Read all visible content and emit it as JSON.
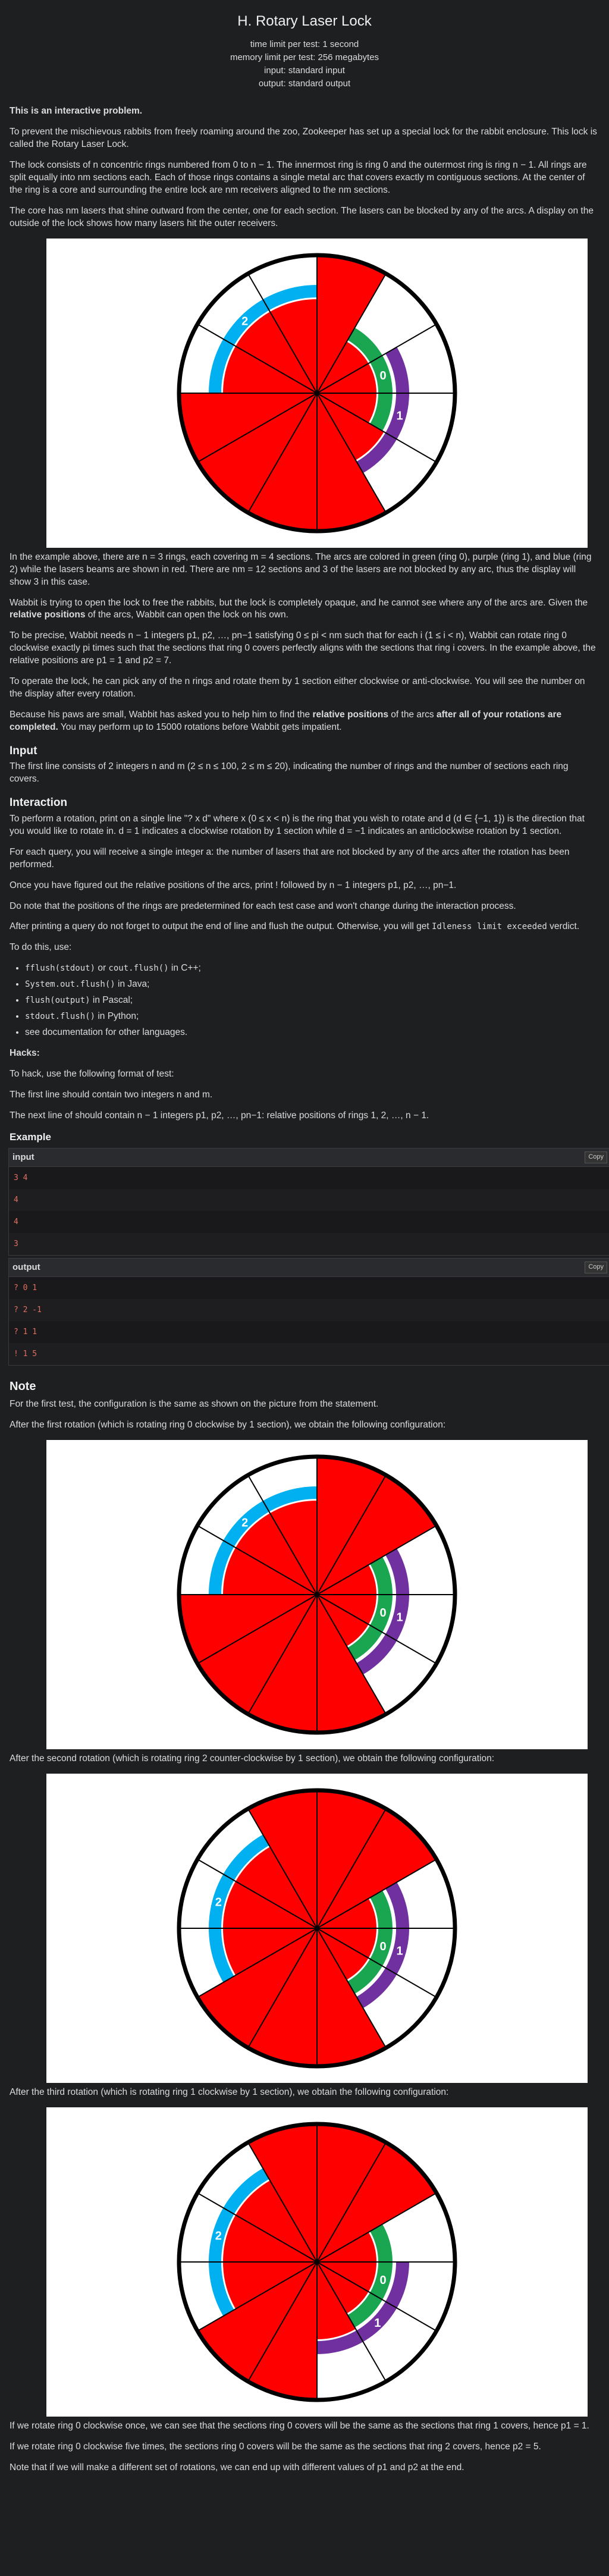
{
  "header": {
    "title": "H. Rotary Laser Lock",
    "time_limit": "time limit per test: 1 second",
    "memory_limit": "memory limit per test: 256 megabytes",
    "input": "input: standard input",
    "output": "output: standard output"
  },
  "statement": {
    "interactive": "This is an interactive problem.",
    "p1": "To prevent the mischievous rabbits from freely roaming around the zoo, Zookeeper has set up a special lock for the rabbit enclosure. This lock is called the Rotary Laser Lock.",
    "p2": "The lock consists of n concentric rings numbered from 0 to n − 1. The innermost ring is ring 0 and the outermost ring is ring n − 1. All rings are split equally into nm sections each. Each of those rings contains a single metal arc that covers exactly m contiguous sections. At the center of the ring is a core and surrounding the entire lock are nm receivers aligned to the nm sections.",
    "p3": "The core has nm lasers that shine outward from the center, one for each section. The lasers can be blocked by any of the arcs. A display on the outside of the lock shows how many lasers hit the outer receivers.",
    "p4": "In the example above, there are n = 3 rings, each covering m = 4 sections. The arcs are colored in green (ring 0), purple (ring 1), and blue (ring 2) while the lasers beams are shown in red. There are nm = 12 sections and 3 of the lasers are not blocked by any arc, thus the display will show 3 in this case.",
    "p5a": "Wabbit is trying to open the lock to free the rabbits, but the lock is completely opaque, and he cannot see where any of the arcs are. Given the ",
    "p5b": "relative positions",
    "p5c": " of the arcs, Wabbit can open the lock on his own.",
    "p6": "To be precise, Wabbit needs n − 1 integers p1, p2, …, pn−1 satisfying 0 ≤ pi < nm such that for each i (1 ≤ i < n), Wabbit can rotate ring 0 clockwise exactly pi times such that the sections that ring 0 covers perfectly aligns with the sections that ring i covers. In the example above, the relative positions are p1 = 1 and p2 = 7.",
    "p7": "To operate the lock, he can pick any of the n rings and rotate them by 1 section either clockwise or anti-clockwise. You will see the number on the display after every rotation.",
    "p8a": "Because his paws are small, Wabbit has asked you to help him to find the ",
    "p8b": "relative positions",
    "p8c": " of the arcs ",
    "p8d": "after all of your rotations are completed.",
    "p8e": " You may perform up to 15000 rotations before Wabbit gets impatient."
  },
  "input_section": {
    "heading": "Input",
    "text": "The first line consists of 2 integers n and m (2 ≤ n ≤ 100, 2 ≤ m ≤ 20), indicating the number of rings and the number of sections each ring covers."
  },
  "interaction": {
    "heading": "Interaction",
    "p1": "To perform a rotation, print on a single line \"? x d\" where x (0 ≤ x < n) is the ring that you wish to rotate and d (d ∈ {−1, 1}) is the direction that you would like to rotate in. d = 1 indicates a clockwise rotation by 1 section while d = −1 indicates an anticlockwise rotation by 1 section.",
    "p2": "For each query, you will receive a single integer a: the number of lasers that are not blocked by any of the arcs after the rotation has been performed.",
    "p3": "Once you have figured out the relative positions of the arcs, print ! followed by n − 1 integers p1, p2, …, pn−1.",
    "p4": "Do note that the positions of the rings are predetermined for each test case and won't change during the interaction process.",
    "p5a": "After printing a query do not forget to output the end of line and flush the output. Otherwise, you will get ",
    "p5b": "Idleness limit exceeded",
    "p5c": " verdict.",
    "p6": "To do this, use:",
    "flush_items": [
      [
        "fflush(stdout)",
        " or ",
        "cout.flush()",
        " in C++;"
      ],
      [
        "System.out.flush()",
        " in Java;"
      ],
      [
        "flush(output)",
        " in Pascal;"
      ],
      [
        "stdout.flush()",
        " in Python;"
      ],
      [
        "see documentation for other languages."
      ]
    ]
  },
  "hacks": {
    "heading": "Hacks:",
    "p1": "To hack, use the following format of test:",
    "p2": "The first line should contain two integers n and m.",
    "p3": "The next line of should contain n − 1 integers p1, p2, …, pn−1: relative positions of rings 1, 2, …, n − 1."
  },
  "example": {
    "heading": "Example",
    "input_label": "input",
    "output_label": "output",
    "copy_label": "Copy",
    "input_lines": [
      "3 4",
      "4",
      "4",
      "3"
    ],
    "output_lines": [
      "? 0 1",
      "? 2 -1",
      "? 1 1",
      "! 1 5"
    ]
  },
  "note": {
    "heading": "Note",
    "p1": "For the first test, the configuration is the same as shown on the picture from the statement.",
    "p2": "After the first rotation (which is rotating ring 0 clockwise by 1 section), we obtain the following configuration:",
    "p3": "After the second rotation (which is rotating ring 2 counter-clockwise by 1 section), we obtain the following configuration:",
    "p4": "After the third rotation (which is rotating ring 1 clockwise by 1 section), we obtain the following configuration:",
    "p5": "If we rotate ring 0 clockwise once, we can see that the sections ring 0 covers will be the same as the sections that ring 1 covers, hence p1 = 1.",
    "p6": "If we rotate ring 0 clockwise five times, the sections ring 0 covers will be the same as the sections that ring 2 covers, hence p2 = 5.",
    "p7": "Note that if we will make a different set of rotations, we can end up with different values of p1 and p2 at the end."
  },
  "colors": {
    "laser": "#ff0000",
    "ring0": "#1aa550",
    "ring1": "#7030a0",
    "ring2": "#00b0f0"
  },
  "figures": [
    {
      "sections": 12,
      "ring_labels": [
        "0",
        "1",
        "2"
      ],
      "ring0": [
        1,
        4
      ],
      "ring1": [
        2,
        5
      ],
      "ring2": [
        9,
        12
      ]
    },
    {
      "sections": 12,
      "ring_labels": [
        "0",
        "1",
        "2"
      ],
      "ring0": [
        2,
        5
      ],
      "ring1": [
        2,
        5
      ],
      "ring2": [
        9,
        12
      ]
    },
    {
      "sections": 12,
      "ring_labels": [
        "0",
        "1",
        "2"
      ],
      "ring0": [
        2,
        5
      ],
      "ring1": [
        2,
        5
      ],
      "ring2": [
        8,
        11
      ]
    },
    {
      "sections": 12,
      "ring_labels": [
        "0",
        "1",
        "2"
      ],
      "ring0": [
        2,
        5
      ],
      "ring1": [
        3,
        6
      ],
      "ring2": [
        8,
        11
      ]
    }
  ]
}
